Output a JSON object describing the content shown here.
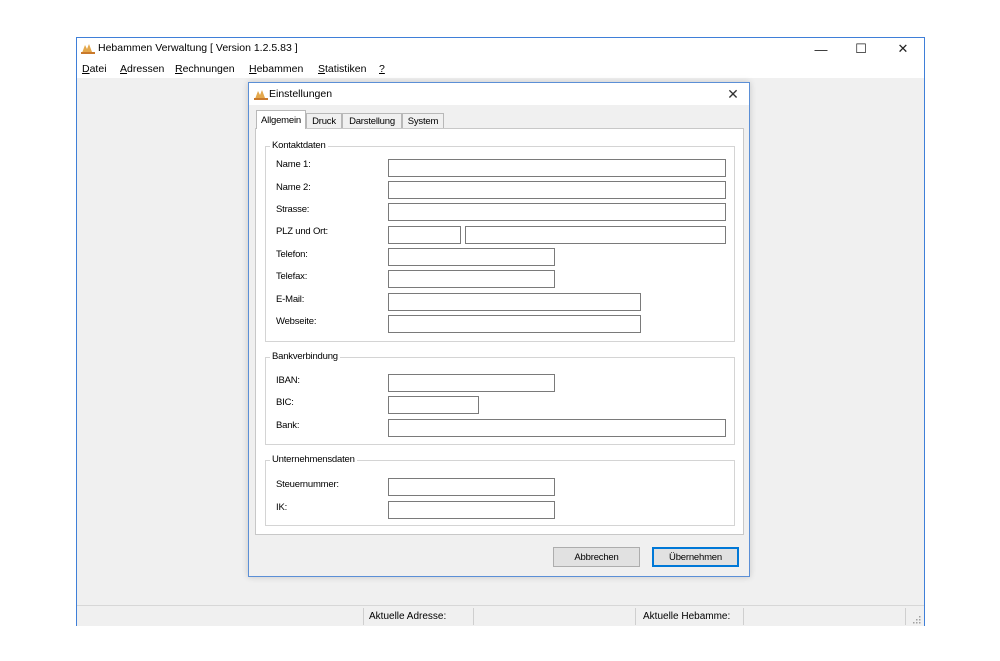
{
  "app": {
    "title": "Hebammen Verwaltung [ Version 1.2.5.83 ]",
    "icon": "app-logo-icon",
    "controls": {
      "minimize": "—",
      "maximize": "☐",
      "close": "✕"
    }
  },
  "menu": [
    {
      "pre": "",
      "ul": "D",
      "post": "atei"
    },
    {
      "pre": "",
      "ul": "A",
      "post": "dressen"
    },
    {
      "pre": "",
      "ul": "R",
      "post": "echnungen"
    },
    {
      "pre": "",
      "ul": "H",
      "post": "ebammen"
    },
    {
      "pre": "",
      "ul": "S",
      "post": "tatistiken"
    },
    {
      "pre": "",
      "ul": "?",
      "post": ""
    }
  ],
  "dialog": {
    "title": "Einstellungen",
    "close": "✕",
    "tabs": [
      "Allgemein",
      "Druck",
      "Darstellung",
      "System"
    ],
    "active_tab": "Allgemein",
    "groups": {
      "kontakt": {
        "title": "Kontaktdaten",
        "fields": {
          "name1": {
            "label": "Name 1:",
            "value": ""
          },
          "name2": {
            "label": "Name 2:",
            "value": ""
          },
          "strasse": {
            "label": "Strasse:",
            "value": ""
          },
          "plzort": {
            "label": "PLZ und Ort:",
            "plz": "",
            "ort": ""
          },
          "telefon": {
            "label": "Telefon:",
            "value": ""
          },
          "telefax": {
            "label": "Telefax:",
            "value": ""
          },
          "email": {
            "label": "E-Mail:",
            "value": ""
          },
          "webseite": {
            "label": "Webseite:",
            "value": ""
          }
        }
      },
      "bank": {
        "title": "Bankverbindung",
        "fields": {
          "iban": {
            "label": "IBAN:",
            "value": ""
          },
          "bic": {
            "label": "BIC:",
            "value": ""
          },
          "bank": {
            "label": "Bank:",
            "value": ""
          }
        }
      },
      "unternehmen": {
        "title": "Unternehmensdaten",
        "fields": {
          "steuernummer": {
            "label": "Steuernummer:",
            "value": ""
          },
          "ik": {
            "label": "IK:",
            "value": ""
          }
        }
      }
    },
    "buttons": {
      "cancel": "Abbrechen",
      "apply": "Übernehmen"
    }
  },
  "statusbar": {
    "current_address_label": "Aktuelle Adresse:",
    "current_midwife_label": "Aktuelle Hebamme:"
  },
  "colors": {
    "window_border": "#3f7fd8",
    "default_button": "#0078d7",
    "chrome_bg": "#f0f0f0"
  }
}
